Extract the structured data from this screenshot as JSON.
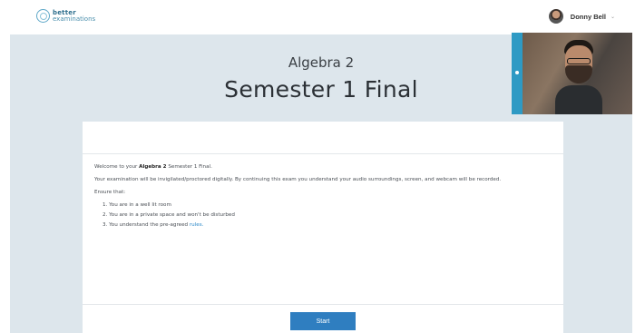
{
  "brand": {
    "line1": "better",
    "line2": "examinations"
  },
  "user": {
    "name": "Donny Bell",
    "caret": "⌄"
  },
  "exam": {
    "subject": "Algebra 2",
    "title": "Semester 1 Final"
  },
  "instructions": {
    "welcome_prefix": "Welcome to your ",
    "welcome_subject": "Algebra 2",
    "welcome_suffix": " Semester 1 Final.",
    "proctor_notice": "Your examination will be invigilated/proctored digitally. By continuing this exam you understand your audio surroundings, screen, and webcam will be recorded.",
    "ensure_heading": "Ensure that:",
    "items": [
      {
        "number": "1.",
        "text": "You are in a well lit room"
      },
      {
        "number": "2.",
        "text": "You are in a private space and won't be disturbed"
      },
      {
        "number": "3.",
        "text": "You understand the pre-agreed "
      }
    ],
    "rules_link": "rules."
  },
  "actions": {
    "start_label": "Start"
  },
  "colors": {
    "accent": "#2f7ec0",
    "page_background": "#dde6ec",
    "webcam_indicator": "#2e9ac4"
  }
}
